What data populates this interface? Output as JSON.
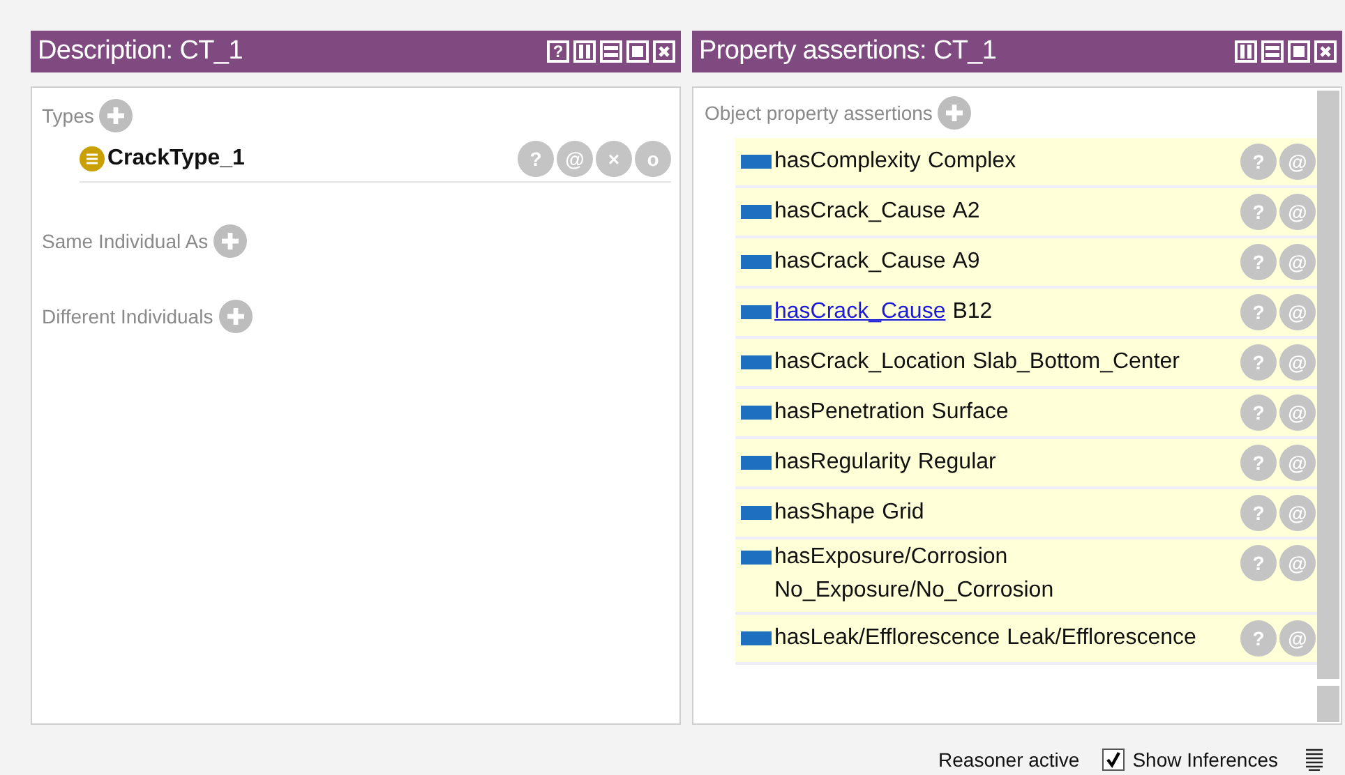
{
  "description_panel": {
    "title": "Description: CT_1",
    "window_buttons": [
      {
        "kind": "help",
        "label": "?"
      },
      {
        "kind": "split-v"
      },
      {
        "kind": "split-h"
      },
      {
        "kind": "maximize"
      },
      {
        "kind": "close"
      }
    ],
    "sections": [
      {
        "label": "Types",
        "items": [
          {
            "name": "CrackType_1",
            "buttons": [
              "?",
              "@",
              "×",
              "o"
            ]
          }
        ]
      },
      {
        "label": "Same Individual As"
      },
      {
        "label": "Different Individuals"
      }
    ]
  },
  "assertions_panel": {
    "title": "Property assertions: CT_1",
    "window_buttons": [
      {
        "kind": "split-v"
      },
      {
        "kind": "split-h"
      },
      {
        "kind": "maximize"
      },
      {
        "kind": "close"
      }
    ],
    "section_label": "Object property assertions",
    "rows": [
      {
        "property": "hasComplexity",
        "value": "Complex",
        "link": false,
        "buttons": [
          "?",
          "@"
        ]
      },
      {
        "property": "hasCrack_Cause",
        "value": "A2",
        "link": false,
        "buttons": [
          "?",
          "@"
        ]
      },
      {
        "property": "hasCrack_Cause",
        "value": "A9",
        "link": false,
        "buttons": [
          "?",
          "@"
        ]
      },
      {
        "property": "hasCrack_Cause",
        "value": "B12",
        "link": true,
        "buttons": [
          "?",
          "@"
        ]
      },
      {
        "property": "hasCrack_Location",
        "value": "Slab_Bottom_Center",
        "link": false,
        "buttons": [
          "?",
          "@"
        ]
      },
      {
        "property": "hasPenetration",
        "value": "Surface",
        "link": false,
        "buttons": [
          "?",
          "@"
        ]
      },
      {
        "property": "hasRegularity",
        "value": "Regular",
        "link": false,
        "buttons": [
          "?",
          "@"
        ]
      },
      {
        "property": "hasShape",
        "value": "Grid",
        "link": false,
        "buttons": [
          "?",
          "@"
        ]
      },
      {
        "property": "hasExposure/Corrosion",
        "value": "No_Exposure/No_Corrosion",
        "link": false,
        "wrapped": true,
        "buttons": [
          "?",
          "@"
        ]
      },
      {
        "property": "hasLeak/Efflorescence",
        "value": "Leak/Efflorescence",
        "link": false,
        "buttons": [
          "?",
          "@"
        ]
      }
    ]
  },
  "status_bar": {
    "reasoner": "Reasoner active",
    "show_inferences": {
      "label": "Show Inferences",
      "checked": true
    }
  }
}
